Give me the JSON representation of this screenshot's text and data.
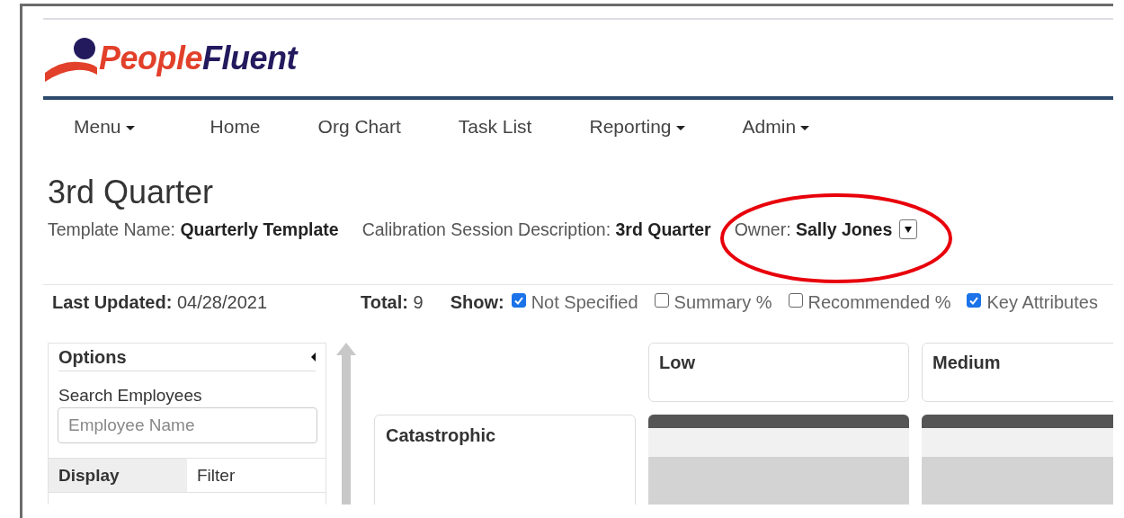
{
  "logo": {
    "part_1": "People",
    "part_2": "Fluent"
  },
  "nav": [
    {
      "label": "Menu",
      "dropdown": true
    },
    {
      "label": "Home",
      "dropdown": false
    },
    {
      "label": "Org Chart",
      "dropdown": false
    },
    {
      "label": "Task List",
      "dropdown": false
    },
    {
      "label": "Reporting",
      "dropdown": true
    },
    {
      "label": "Admin",
      "dropdown": true
    }
  ],
  "page_title": "3rd Quarter",
  "details": [
    {
      "label": "Template Name:",
      "value": "Quarterly Template",
      "dropdown": false
    },
    {
      "label": "Calibration Session Description:",
      "value": "3rd Quarter",
      "dropdown": false
    },
    {
      "label": "Owner:",
      "value": "Sally Jones",
      "dropdown": true
    }
  ],
  "last_updated": {
    "label": "Last Updated:",
    "value": "04/28/2021"
  },
  "total": {
    "label": "Total:",
    "value": "9"
  },
  "show": {
    "label": "Show:",
    "options": [
      {
        "label": "Not Specified",
        "checked": true
      },
      {
        "label": "Summary %",
        "checked": false
      },
      {
        "label": "Recommended %",
        "checked": false
      },
      {
        "label": "Key Attributes",
        "checked": true
      }
    ]
  },
  "options_panel": {
    "title": "Options",
    "search_label": "Search Employees",
    "placeholder": "Employee Name",
    "tabs": [
      {
        "label": "Display",
        "selected": true
      },
      {
        "label": "Filter",
        "selected": false
      }
    ]
  },
  "grid": {
    "columns": [
      "Low",
      "Medium"
    ],
    "rows": [
      "Catastrophic"
    ]
  }
}
